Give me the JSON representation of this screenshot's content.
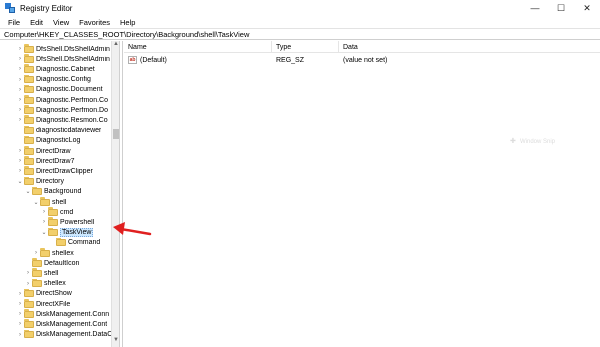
{
  "window": {
    "title": "Registry Editor",
    "minimize": "—",
    "maximize": "☐",
    "close": "✕"
  },
  "menu": [
    "File",
    "Edit",
    "View",
    "Favorites",
    "Help"
  ],
  "address": "Computer\\HKEY_CLASSES_ROOT\\Directory\\Background\\shell\\TaskView",
  "tree": [
    {
      "label": "DfsShell.DfsShellAdmin",
      "depth": 1,
      "expander": ">",
      "selected": false
    },
    {
      "label": "DfsShell.DfsShellAdmin",
      "depth": 1,
      "expander": ">",
      "selected": false
    },
    {
      "label": "Diagnostic.Cabinet",
      "depth": 1,
      "expander": ">",
      "selected": false
    },
    {
      "label": "Diagnostic.Config",
      "depth": 1,
      "expander": ">",
      "selected": false
    },
    {
      "label": "Diagnostic.Document",
      "depth": 1,
      "expander": ">",
      "selected": false
    },
    {
      "label": "Diagnostic.Perfmon.Co",
      "depth": 1,
      "expander": ">",
      "selected": false
    },
    {
      "label": "Diagnostic.Perfmon.Do",
      "depth": 1,
      "expander": ">",
      "selected": false
    },
    {
      "label": "Diagnostic.Resmon.Co",
      "depth": 1,
      "expander": ">",
      "selected": false
    },
    {
      "label": "diagnosticdataviewer",
      "depth": 1,
      "expander": "",
      "selected": false
    },
    {
      "label": "DiagnosticLog",
      "depth": 1,
      "expander": "",
      "selected": false
    },
    {
      "label": "DirectDraw",
      "depth": 1,
      "expander": ">",
      "selected": false
    },
    {
      "label": "DirectDraw7",
      "depth": 1,
      "expander": ">",
      "selected": false
    },
    {
      "label": "DirectDrawClipper",
      "depth": 1,
      "expander": ">",
      "selected": false
    },
    {
      "label": "Directory",
      "depth": 1,
      "expander": "v",
      "selected": false
    },
    {
      "label": "Background",
      "depth": 2,
      "expander": "v",
      "selected": false
    },
    {
      "label": "shell",
      "depth": 3,
      "expander": "v",
      "selected": false
    },
    {
      "label": "cmd",
      "depth": 4,
      "expander": ">",
      "selected": false
    },
    {
      "label": "Powershell",
      "depth": 4,
      "expander": ">",
      "selected": false
    },
    {
      "label": "TaskView",
      "depth": 4,
      "expander": "v",
      "selected": true
    },
    {
      "label": "Command",
      "depth": 5,
      "expander": "",
      "selected": false
    },
    {
      "label": "shellex",
      "depth": 3,
      "expander": ">",
      "selected": false
    },
    {
      "label": "DefaultIcon",
      "depth": 2,
      "expander": "",
      "selected": false
    },
    {
      "label": "shell",
      "depth": 2,
      "expander": ">",
      "selected": false
    },
    {
      "label": "shellex",
      "depth": 2,
      "expander": ">",
      "selected": false
    },
    {
      "label": "DirectShow",
      "depth": 1,
      "expander": ">",
      "selected": false
    },
    {
      "label": "DirectXFile",
      "depth": 1,
      "expander": ">",
      "selected": false
    },
    {
      "label": "DiskManagement.Conn",
      "depth": 1,
      "expander": ">",
      "selected": false
    },
    {
      "label": "DiskManagement.Cont",
      "depth": 1,
      "expander": ">",
      "selected": false
    },
    {
      "label": "DiskManagement.DataO",
      "depth": 1,
      "expander": ">",
      "selected": false
    }
  ],
  "list": {
    "columns": {
      "name": "Name",
      "type": "Type",
      "data": "Data"
    },
    "rows": [
      {
        "icon": "ab",
        "name": "(Default)",
        "type": "REG_SZ",
        "data": "(value not set)"
      }
    ]
  },
  "ghost_text": "Window Snip",
  "colors": {
    "selection": "#cce8ff",
    "folder": "#f2cf6b",
    "arrow": "#e02020"
  }
}
